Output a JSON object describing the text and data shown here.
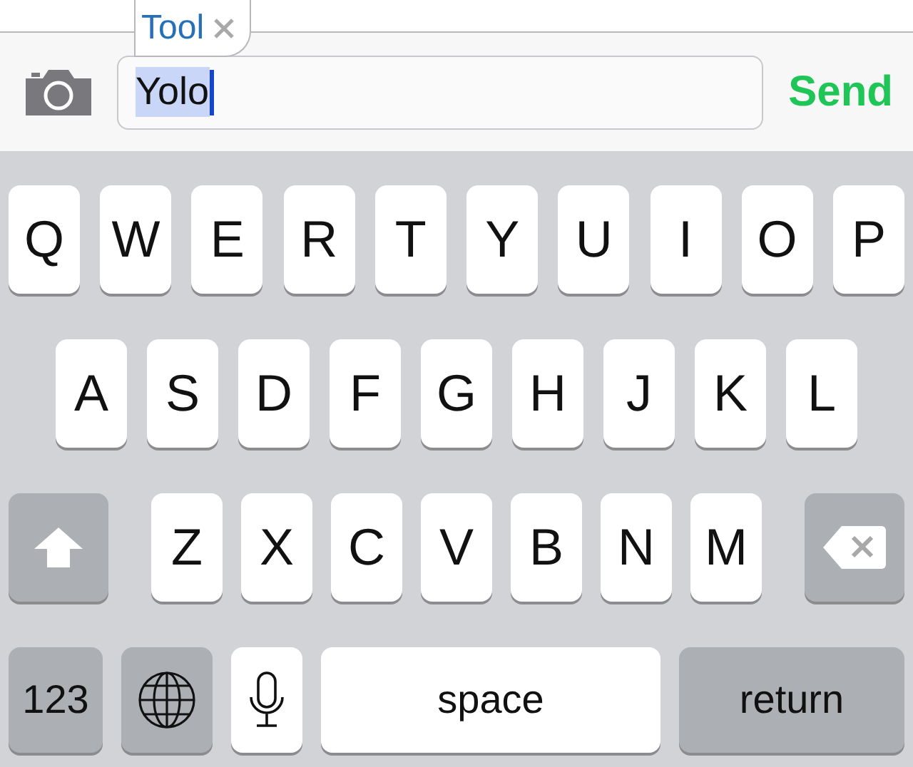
{
  "suggestion": {
    "label": "Tool"
  },
  "composer": {
    "value": "Yolo",
    "text_selected": true,
    "send": "Send"
  },
  "keyboard": {
    "rows": [
      {
        "keys": [
          {
            "kind": "letter",
            "label": "Q"
          },
          {
            "kind": "letter",
            "label": "W"
          },
          {
            "kind": "letter",
            "label": "E"
          },
          {
            "kind": "letter",
            "label": "R"
          },
          {
            "kind": "letter",
            "label": "T"
          },
          {
            "kind": "letter",
            "label": "Y"
          },
          {
            "kind": "letter",
            "label": "U"
          },
          {
            "kind": "letter",
            "label": "I"
          },
          {
            "kind": "letter",
            "label": "O"
          },
          {
            "kind": "letter",
            "label": "P"
          }
        ]
      },
      {
        "keys": [
          {
            "kind": "letter",
            "label": "A"
          },
          {
            "kind": "letter",
            "label": "S"
          },
          {
            "kind": "letter",
            "label": "D"
          },
          {
            "kind": "letter",
            "label": "F"
          },
          {
            "kind": "letter",
            "label": "G"
          },
          {
            "kind": "letter",
            "label": "H"
          },
          {
            "kind": "letter",
            "label": "J"
          },
          {
            "kind": "letter",
            "label": "K"
          },
          {
            "kind": "letter",
            "label": "L"
          }
        ]
      },
      {
        "keys": [
          {
            "kind": "shift"
          },
          {
            "kind": "letter",
            "label": "Z"
          },
          {
            "kind": "letter",
            "label": "X"
          },
          {
            "kind": "letter",
            "label": "C"
          },
          {
            "kind": "letter",
            "label": "V"
          },
          {
            "kind": "letter",
            "label": "B"
          },
          {
            "kind": "letter",
            "label": "N"
          },
          {
            "kind": "letter",
            "label": "M"
          },
          {
            "kind": "delete"
          }
        ]
      },
      {
        "keys": [
          {
            "kind": "numbers",
            "label": "123"
          },
          {
            "kind": "globe"
          },
          {
            "kind": "mic"
          },
          {
            "kind": "space",
            "label": "space"
          },
          {
            "kind": "return",
            "label": "return"
          }
        ]
      }
    ]
  }
}
